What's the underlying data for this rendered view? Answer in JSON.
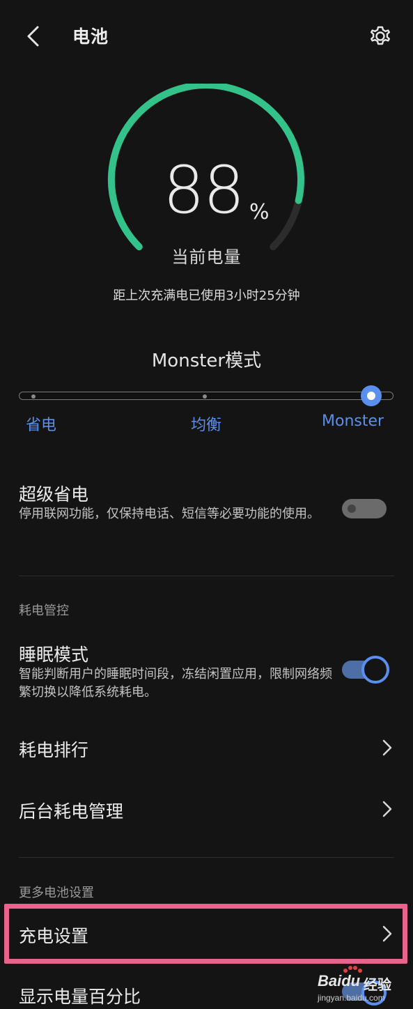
{
  "header": {
    "title": "电池"
  },
  "battery": {
    "level": 88,
    "level_unit": "%",
    "caption": "当前电量",
    "usage_text": "距上次充满电已使用3小时25分钟",
    "ring_color": "#33c28a"
  },
  "mode": {
    "title": "Monster模式",
    "options": [
      "省电",
      "均衡",
      "Monster"
    ],
    "selected": "Monster",
    "accent": "#5a8ff0"
  },
  "super_saver": {
    "title": "超级省电",
    "description": "停用联网功能，仅保持电话、短信等必要功能的使用。",
    "enabled": false
  },
  "power_control": {
    "section_label": "耗电管控",
    "sleep_mode": {
      "title": "睡眠模式",
      "description": "智能判断用户的睡眠时间段，冻结闲置应用，限制网络频繁切换以降低系统耗电。",
      "enabled": true
    },
    "items": [
      {
        "label": "耗电排行"
      },
      {
        "label": "后台耗电管理"
      }
    ]
  },
  "more_settings": {
    "section_label": "更多电池设置",
    "items": [
      {
        "label": "充电设置"
      },
      {
        "label": "显示电量百分比"
      }
    ],
    "highlight_color": "#e8648a"
  },
  "watermark": {
    "brand": "Baidu",
    "brand2": "经验",
    "url": "jingyan.baidu.com"
  }
}
